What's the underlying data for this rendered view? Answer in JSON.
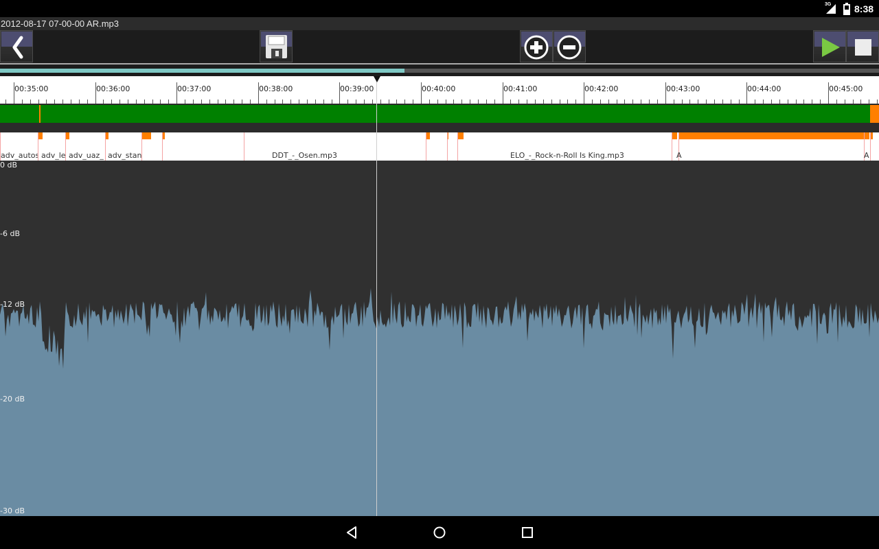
{
  "status_bar": {
    "network": "3G",
    "time": "8:38"
  },
  "title": "2012-08-17 07-00-00 AR.mp3",
  "toolbar": {
    "back": "back-arrow-icon",
    "save": "floppy-disk-icon",
    "zoom_in": "plus-circle-icon",
    "zoom_out": "minus-circle-icon",
    "play": "play-icon",
    "stop": "stop-icon"
  },
  "playback_progress": 0.46,
  "timeline_labels": [
    "00:35:00",
    "00:36:00",
    "00:37:00",
    "00:38:00",
    "00:39:00",
    "00:40:00",
    "00:41:00",
    "00:42:00",
    "00:43:00",
    "00:44:00",
    "00:45:00"
  ],
  "tracks": {
    "adv_autos": "adv_autos",
    "adv_le": "adv_le",
    "adv_uaz": "adv_uaz_",
    "adv_stan": "adv_stan",
    "ddt": "DDT_-_Osen.mp3",
    "elo": "ELO_-_Rock-n-Roll Is King.mp3",
    "a1": "A",
    "a2": "A"
  },
  "db_scale": [
    "0 dB",
    "-6 dB",
    "-12 dB",
    "-20 dB",
    "-30 dB"
  ],
  "colors": {
    "waveform": "#6a8ca3",
    "segment_green": "#008000",
    "marker_orange": "#ff7f00",
    "progress": "#7fc9c5"
  },
  "navbar": {
    "back": "nav-back-icon",
    "home": "nav-home-icon",
    "recents": "nav-recents-icon"
  }
}
